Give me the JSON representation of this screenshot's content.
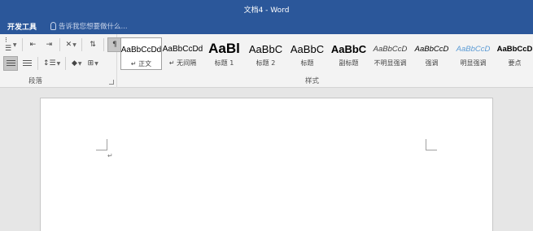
{
  "window": {
    "title": "文档4 - Word"
  },
  "tabs": {
    "developer": "开发工具"
  },
  "tell_me": {
    "placeholder": "告诉我您想要做什么..."
  },
  "paragraph_group": {
    "label": "段落",
    "icons": [
      "multilevel-list-icon",
      "decrease-indent-icon",
      "increase-indent-icon",
      "asian-layout-icon",
      "sort-icon",
      "show-marks-icon",
      "align-justify-icon",
      "distributed-icon",
      "line-spacing-icon",
      "shading-icon",
      "borders-icon"
    ]
  },
  "styles_group": {
    "label": "样式",
    "items": [
      {
        "preview": "AaBbCcDd",
        "name": "↵ 正文",
        "selected": true
      },
      {
        "preview": "AaBbCcDd",
        "name": "↵ 无间隔"
      },
      {
        "preview": "AaBl",
        "name": "标题 1"
      },
      {
        "preview": "AaBbC",
        "name": "标题 2"
      },
      {
        "preview": "AaBbC",
        "name": "标题"
      },
      {
        "preview": "AaBbC",
        "name": "副标题"
      },
      {
        "preview": "AaBbCcD",
        "name": "不明显强调"
      },
      {
        "preview": "AaBbCcD",
        "name": "强调"
      },
      {
        "preview": "AaBbCcD",
        "name": "明显强调"
      },
      {
        "preview": "AaBbCcD",
        "name": "要点"
      }
    ]
  },
  "document": {
    "paragraph_mark": "↵"
  },
  "colors": {
    "title_bar": "#2b579a",
    "ribbon_bg": "#f3f3f3",
    "canvas_bg": "#e6e6e6",
    "subtle_emphasis": "#404040",
    "intense_emphasis": "#5b9bd5"
  }
}
